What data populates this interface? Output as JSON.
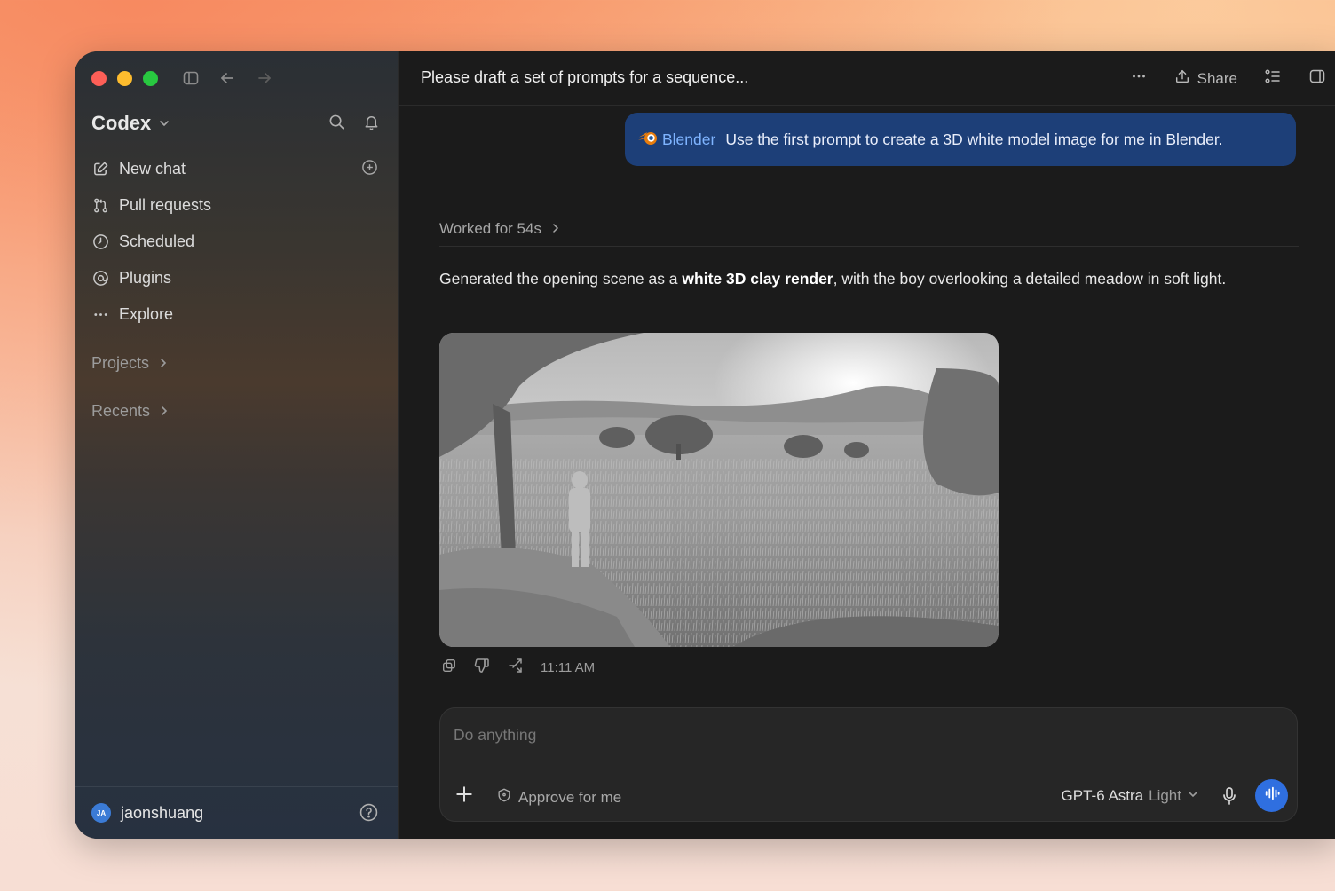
{
  "window": {
    "title": "Please draft a set of prompts for a sequence..."
  },
  "sidebar": {
    "brand": "Codex",
    "items": [
      {
        "label": "New chat",
        "icon": "edit-icon"
      },
      {
        "label": "Pull requests",
        "icon": "pull-request-icon"
      },
      {
        "label": "Scheduled",
        "icon": "clock-icon"
      },
      {
        "label": "Plugins",
        "icon": "at-icon"
      },
      {
        "label": "Explore",
        "icon": "more-horizontal-icon"
      }
    ],
    "sections": {
      "projects": "Projects",
      "recents": "Recents"
    },
    "user": {
      "initials": "JA",
      "name": "jaonshuang"
    }
  },
  "header": {
    "share_label": "Share"
  },
  "conversation": {
    "user_message": {
      "app_tag": "Blender",
      "text": "Use the first prompt to create a 3D white model image for me in Blender."
    },
    "worked_for": "Worked for 54s",
    "answer": {
      "before": "Generated the opening scene as a ",
      "bold": "white 3D clay render",
      "after": ", with the boy overlooking a detailed meadow in soft light."
    },
    "timestamp": "11:11 AM"
  },
  "composer": {
    "placeholder": "Do anything",
    "approve_label": "Approve for me",
    "model_name": "GPT-6 Astra",
    "model_mode": "Light"
  },
  "colors": {
    "accent": "#2f6fe0",
    "user_bubble": "#1d3f78",
    "blender_orange": "#e87d0d"
  }
}
